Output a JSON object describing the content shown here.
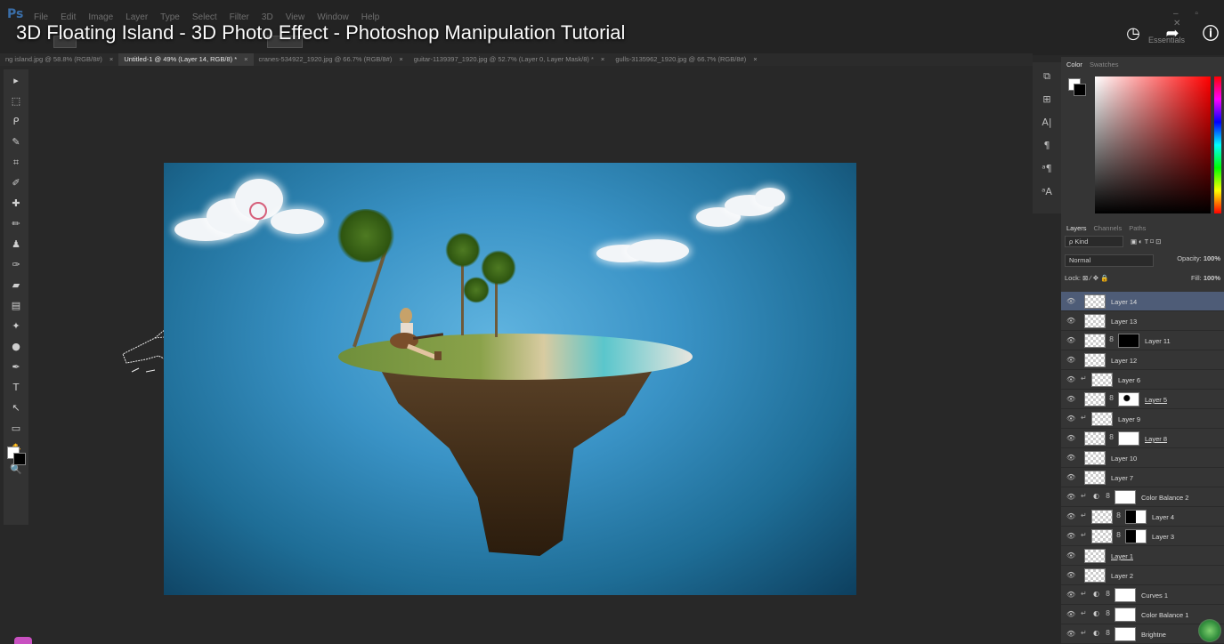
{
  "app": {
    "logo": "Ps",
    "menu": [
      "File",
      "Edit",
      "Image",
      "Layer",
      "Type",
      "Select",
      "Filter",
      "3D",
      "View",
      "Window",
      "Help"
    ],
    "workspace": "Essentials"
  },
  "overlay": {
    "video_title": "3D Floating Island - 3D Photo Effect - Photoshop Manipulation Tutorial",
    "icons": [
      "clock-icon",
      "share-icon",
      "info-icon"
    ]
  },
  "tabs": [
    {
      "label": "ng island.jpg @ 58.8% (RGB/8#)",
      "active": false
    },
    {
      "label": "Untitled-1 @ 49% (Layer 14, RGB/8) *",
      "active": true
    },
    {
      "label": "cranes-534922_1920.jpg @ 66.7% (RGB/8#)",
      "active": false
    },
    {
      "label": "guitar-1139397_1920.jpg @ 52.7% (Layer 0, Layer Mask/8) *",
      "active": false
    },
    {
      "label": "gulls-3135962_1920.jpg @ 66.7% (RGB/8#)",
      "active": false
    }
  ],
  "tab_close": "×",
  "tools": [
    "move-tool",
    "marquee-tool",
    "lasso-tool",
    "quick-select-tool",
    "crop-tool",
    "eyedropper-tool",
    "healing-brush-tool",
    "brush-tool",
    "clone-stamp-tool",
    "history-brush-tool",
    "eraser-tool",
    "gradient-tool",
    "blur-tool",
    "dodge-tool",
    "pen-tool",
    "type-tool",
    "path-selection-tool",
    "shape-tool",
    "hand-tool",
    "zoom-tool"
  ],
  "tool_glyphs": [
    "▸",
    "⬚",
    "ᑭ",
    "✎",
    "⌗",
    "✐",
    "✚",
    "✏",
    "♟",
    "✑",
    "▰",
    "▤",
    "✦",
    "●",
    "✒",
    "T",
    "↖",
    "▭",
    "✋",
    "🔍"
  ],
  "dock": [
    "history-panel-icon",
    "properties-panel-icon",
    "character-panel-icon",
    "paragraph-panel-icon",
    "character-styles-icon",
    "paragraph-styles-icon"
  ],
  "dock_glyphs": [
    "⧉",
    "⊞",
    "A|",
    "¶",
    "ᵃ¶",
    "ᵃA"
  ],
  "color_panel": {
    "tabs": [
      "Color",
      "Swatches"
    ],
    "active": "Color"
  },
  "layers_panel": {
    "tabs": [
      "Layers",
      "Channels",
      "Paths"
    ],
    "active": "Layers",
    "kind_label": "ρ Kind",
    "filter_icons": "▣ ◐ T ⌑ ⊡",
    "blend_mode": "Normal",
    "opacity_label": "Opacity:",
    "opacity": "100%",
    "lock_label": "Lock:",
    "lock_icons": "⊠ ∕ ✥ 🔒",
    "fill_label": "Fill:",
    "fill": "100%",
    "layers": [
      {
        "name": "Layer 14",
        "selected": true,
        "clip": false,
        "adj": false,
        "mask": null,
        "underline": false
      },
      {
        "name": "Layer 13",
        "selected": false,
        "clip": false,
        "adj": false,
        "mask": null,
        "underline": false
      },
      {
        "name": "Layer 11",
        "selected": false,
        "clip": false,
        "adj": false,
        "mask": "black",
        "underline": false
      },
      {
        "name": "Layer 12",
        "selected": false,
        "clip": false,
        "adj": false,
        "mask": null,
        "underline": false
      },
      {
        "name": "Layer 6",
        "selected": false,
        "clip": true,
        "adj": false,
        "mask": null,
        "underline": false
      },
      {
        "name": "Layer 5",
        "selected": false,
        "clip": false,
        "adj": false,
        "mask": "white-dot",
        "underline": true
      },
      {
        "name": "Layer 9",
        "selected": false,
        "clip": true,
        "adj": false,
        "mask": null,
        "underline": false
      },
      {
        "name": "Layer 8",
        "selected": false,
        "clip": false,
        "adj": false,
        "mask": "white",
        "underline": true
      },
      {
        "name": "Layer 10",
        "selected": false,
        "clip": false,
        "adj": false,
        "mask": null,
        "underline": false
      },
      {
        "name": "Layer 7",
        "selected": false,
        "clip": false,
        "adj": false,
        "mask": null,
        "underline": false
      },
      {
        "name": "Color Balance 2",
        "selected": false,
        "clip": true,
        "adj": true,
        "mask": "white",
        "underline": false
      },
      {
        "name": "Layer 4",
        "selected": false,
        "clip": true,
        "adj": false,
        "mask": "black-white",
        "underline": false
      },
      {
        "name": "Layer 3",
        "selected": false,
        "clip": true,
        "adj": false,
        "mask": "black-white",
        "underline": false
      },
      {
        "name": "Layer 1",
        "selected": false,
        "clip": false,
        "adj": false,
        "mask": null,
        "underline": true
      },
      {
        "name": "Layer 2",
        "selected": false,
        "clip": false,
        "adj": false,
        "mask": null,
        "underline": false
      },
      {
        "name": "Curves 1",
        "selected": false,
        "clip": true,
        "adj": true,
        "mask": "curves",
        "underline": false
      },
      {
        "name": "Color Balance 1",
        "selected": false,
        "clip": true,
        "adj": true,
        "mask": "white",
        "underline": false
      },
      {
        "name": "Brightne",
        "selected": false,
        "clip": true,
        "adj": true,
        "mask": "white",
        "underline": false
      }
    ]
  },
  "glyphs": {
    "eye": "👁",
    "clip": "↵",
    "adj": "◐",
    "link": "8"
  }
}
